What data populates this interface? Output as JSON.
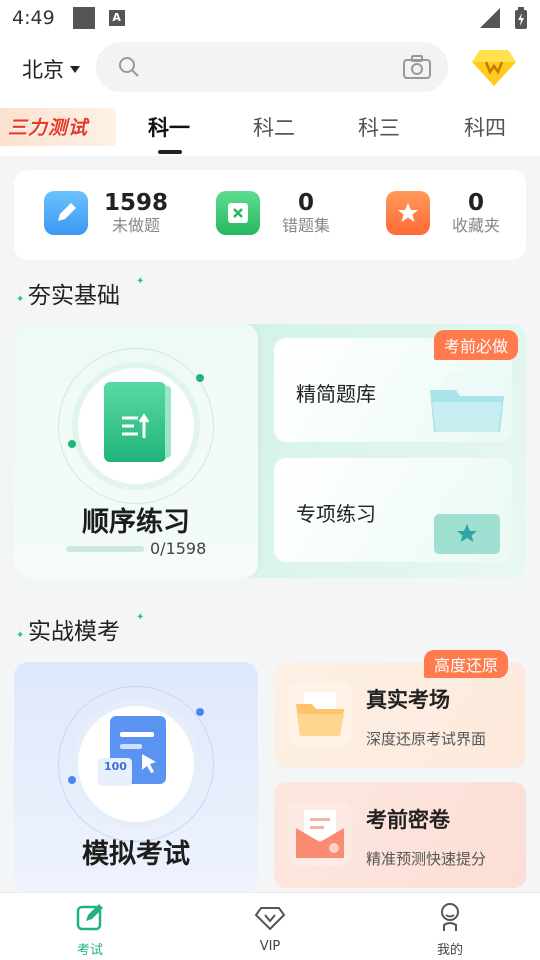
{
  "status_bar": {
    "time": "4:49"
  },
  "header": {
    "city": "北京",
    "search_placeholder": ""
  },
  "promo": {
    "label": "三力测试"
  },
  "tabs": [
    {
      "label": "科一",
      "active": true
    },
    {
      "label": "科二",
      "active": false
    },
    {
      "label": "科三",
      "active": false
    },
    {
      "label": "科四",
      "active": false
    }
  ],
  "stats": [
    {
      "value": "1598",
      "label": "未做题",
      "icon": "pencil-icon",
      "color": "#4aa8f5"
    },
    {
      "value": "0",
      "label": "错题集",
      "icon": "wrong-icon",
      "color": "#3ccb72"
    },
    {
      "value": "0",
      "label": "收藏夹",
      "icon": "star-icon",
      "color": "#ff7a45"
    }
  ],
  "section_basics": {
    "title": "夯实基础",
    "sequential": {
      "title": "顺序练习",
      "progress_text": "0/1598",
      "progress": 0.0
    },
    "cards": [
      {
        "title": "精简题库",
        "badge": "考前必做"
      },
      {
        "title": "专项练习"
      }
    ]
  },
  "section_exam": {
    "title": "实战模考",
    "mock": {
      "title": "模拟考试",
      "paper_score": "100"
    },
    "cards": [
      {
        "title": "真实考场",
        "subtitle": "深度还原考试界面",
        "badge": "高度还原",
        "color": "#fdeee1"
      },
      {
        "title": "考前密卷",
        "subtitle": "精准预测快速提分",
        "color": "#fde6e0"
      }
    ]
  },
  "bottom_nav": [
    {
      "label": "考试",
      "icon": "exam-edit-icon",
      "active": true
    },
    {
      "label": "VIP",
      "icon": "diamond-icon",
      "active": false
    },
    {
      "label": "我的",
      "icon": "user-icon",
      "active": false
    }
  ],
  "colors": {
    "accent": "#22b37a",
    "badge": "#ff7a4d"
  }
}
